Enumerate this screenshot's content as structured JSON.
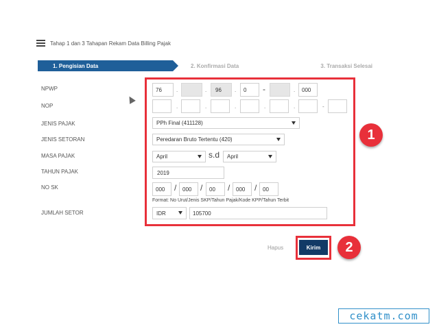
{
  "header": {
    "menu_icon": "hamburger-menu-icon",
    "title": "Tahap 1 dan 3 Tahapan Rekam Data Billing Pajak"
  },
  "steps": [
    {
      "label": "1. Pengisian Data"
    },
    {
      "label": "2. Konfirmasi Data"
    },
    {
      "label": "3. Transaksi Selesai"
    }
  ],
  "labels": {
    "npwp": "NPWP",
    "nop": "NOP",
    "jenis_pajak": "JENIS PAJAK",
    "jenis_setoran": "JENIS SETORAN",
    "masa_pajak": "MASA PAJAK",
    "tahun_pajak": "TAHUN PAJAK",
    "no_sk": "NO SK",
    "jumlah_setor": "JUMLAH SETOR"
  },
  "npwp": {
    "part1": "76",
    "part2": "",
    "part3": "96",
    "part4": "0",
    "part5": "",
    "part6": "000",
    "sep_dot": ".",
    "sep_dash": "-"
  },
  "nop": {
    "sep_dot": ".",
    "sep_dash": "-"
  },
  "jenis_pajak": {
    "value": "PPh Final (411128)"
  },
  "jenis_setoran": {
    "value": "Peredaran Bruto Tertentu (420)"
  },
  "masa_pajak": {
    "from": "April",
    "sep": "s.d",
    "to": "April"
  },
  "tahun_pajak": {
    "value": "2019"
  },
  "no_sk": {
    "part1": "000",
    "part2": "000",
    "part3": "00",
    "part4": "000",
    "part5": "00",
    "sep": "/",
    "format_note": "Format: No Urut/Jenis SKP/Tahun Pajak/Kode KPP/Tahun Terbit"
  },
  "jumlah_setor": {
    "currency": "IDR",
    "value": "105700"
  },
  "actions": {
    "reset_label": "Hapus",
    "submit_label": "Kirim"
  },
  "annotations": {
    "marker1": "1",
    "marker2": "2",
    "highlight_color": "#e8303a"
  },
  "watermark": "cekatm.com",
  "colors": {
    "accent": "#1f5f99",
    "submit": "#123a66",
    "watermark": "#2f8fc9"
  }
}
